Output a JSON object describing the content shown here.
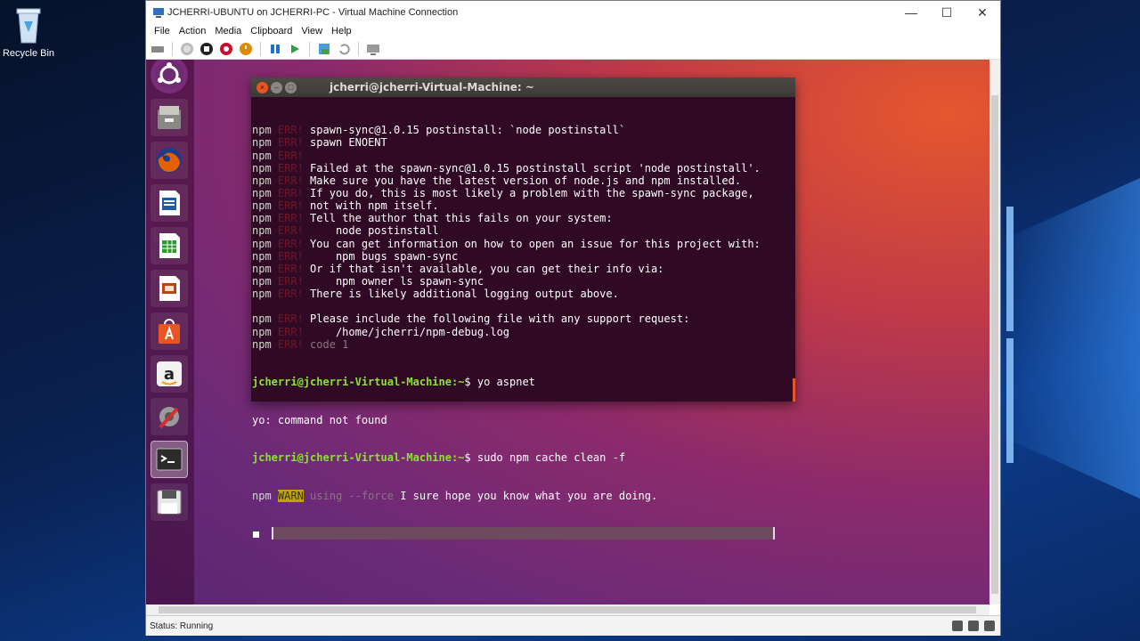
{
  "desktop": {
    "recycle_bin_label": "Recycle Bin"
  },
  "vm_window": {
    "title": "JCHERRI-UBUNTU on JCHERRI-PC - Virtual Machine Connection",
    "menu": [
      "File",
      "Action",
      "Media",
      "Clipboard",
      "View",
      "Help"
    ],
    "status": "Status: Running"
  },
  "launcher": {
    "items": [
      "ubuntu-dash",
      "files",
      "firefox",
      "libreoffice-writer",
      "libreoffice-calc",
      "libreoffice-impress",
      "ubuntu-software",
      "amazon",
      "system-settings",
      "terminal",
      "floppy-disk"
    ]
  },
  "terminal": {
    "title": "jcherri@jcherri-Virtual-Machine: ~",
    "lines": [
      {
        "pfx": "npm",
        "tag": "ERR!",
        "text": " spawn-sync@1.0.15 postinstall: `node postinstall`"
      },
      {
        "pfx": "npm",
        "tag": "ERR!",
        "text": " spawn ENOENT"
      },
      {
        "pfx": "npm",
        "tag": "ERR!",
        "text": ""
      },
      {
        "pfx": "npm",
        "tag": "ERR!",
        "text": " Failed at the spawn-sync@1.0.15 postinstall script 'node postinstall'."
      },
      {
        "pfx": "npm",
        "tag": "ERR!",
        "text": " Make sure you have the latest version of node.js and npm installed."
      },
      {
        "pfx": "npm",
        "tag": "ERR!",
        "text": " If you do, this is most likely a problem with the spawn-sync package,"
      },
      {
        "pfx": "npm",
        "tag": "ERR!",
        "text": " not with npm itself."
      },
      {
        "pfx": "npm",
        "tag": "ERR!",
        "text": " Tell the author that this fails on your system:"
      },
      {
        "pfx": "npm",
        "tag": "ERR!",
        "text": "     node postinstall"
      },
      {
        "pfx": "npm",
        "tag": "ERR!",
        "text": " You can get information on how to open an issue for this project with:"
      },
      {
        "pfx": "npm",
        "tag": "ERR!",
        "text": "     npm bugs spawn-sync"
      },
      {
        "pfx": "npm",
        "tag": "ERR!",
        "text": " Or if that isn't available, you can get their info via:"
      },
      {
        "pfx": "npm",
        "tag": "ERR!",
        "text": "     npm owner ls spawn-sync"
      },
      {
        "pfx": "npm",
        "tag": "ERR!",
        "text": " There is likely additional logging output above."
      },
      {
        "pfx": "",
        "tag": "",
        "text": ""
      },
      {
        "pfx": "npm",
        "tag": "ERR!",
        "text": " Please include the following file with any support request:"
      },
      {
        "pfx": "npm",
        "tag": "ERR!",
        "text": "     /home/jcherri/npm-debug.log"
      },
      {
        "pfx": "npm",
        "tag": "ERR!",
        "text": " code 1",
        "dim": true
      }
    ],
    "prompt1": "jcherri@jcherri-Virtual-Machine:~",
    "cmd1": "$ yo aspnet",
    "out1": "yo: command not found",
    "prompt2": "jcherri@jcherri-Virtual-Machine:~",
    "cmd2": "$ sudo npm cache clean -f",
    "warn_pfx": "npm",
    "warn_tag": "WARN",
    "warn_flag": " using --force",
    "warn_text": " I sure hope you know what you are doing."
  }
}
